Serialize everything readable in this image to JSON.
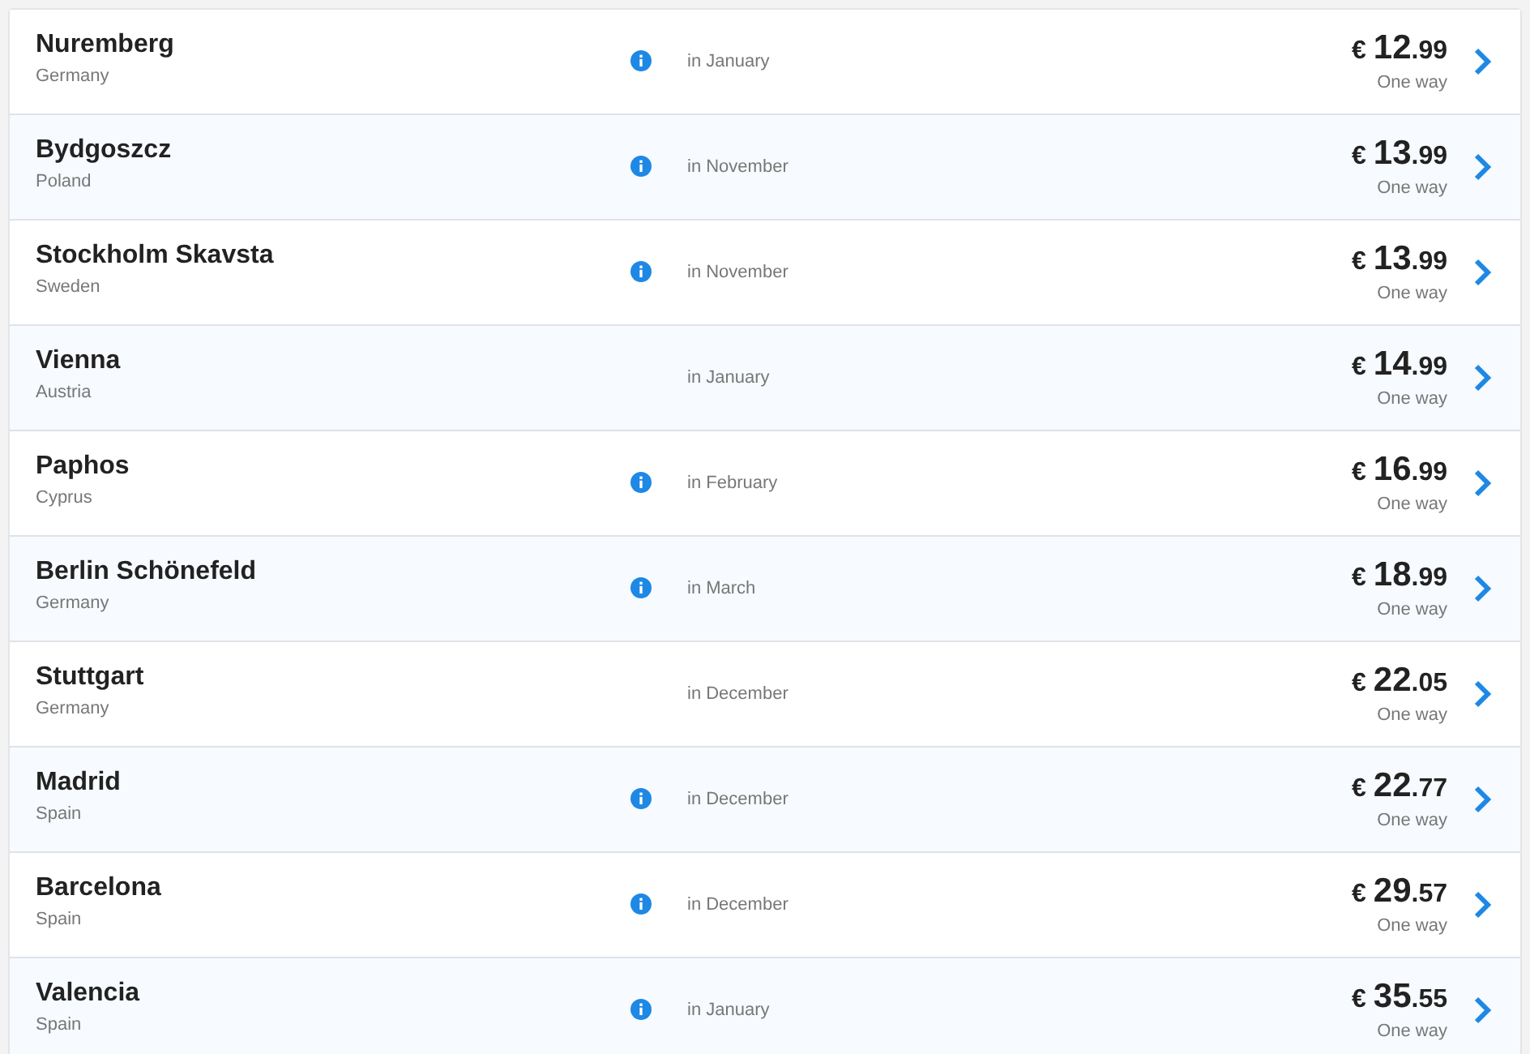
{
  "destinations": [
    {
      "city": "Nuremberg",
      "country": "Germany",
      "info": true,
      "when": "in January",
      "currency": "€",
      "whole": "12",
      "cents": ".99",
      "trip": "One way"
    },
    {
      "city": "Bydgoszcz",
      "country": "Poland",
      "info": true,
      "when": "in November",
      "currency": "€",
      "whole": "13",
      "cents": ".99",
      "trip": "One way"
    },
    {
      "city": "Stockholm Skavsta",
      "country": "Sweden",
      "info": true,
      "when": "in November",
      "currency": "€",
      "whole": "13",
      "cents": ".99",
      "trip": "One way"
    },
    {
      "city": "Vienna",
      "country": "Austria",
      "info": false,
      "when": "in January",
      "currency": "€",
      "whole": "14",
      "cents": ".99",
      "trip": "One way"
    },
    {
      "city": "Paphos",
      "country": "Cyprus",
      "info": true,
      "when": "in February",
      "currency": "€",
      "whole": "16",
      "cents": ".99",
      "trip": "One way"
    },
    {
      "city": "Berlin Schönefeld",
      "country": "Germany",
      "info": true,
      "when": "in March",
      "currency": "€",
      "whole": "18",
      "cents": ".99",
      "trip": "One way"
    },
    {
      "city": "Stuttgart",
      "country": "Germany",
      "info": false,
      "when": "in December",
      "currency": "€",
      "whole": "22",
      "cents": ".05",
      "trip": "One way"
    },
    {
      "city": "Madrid",
      "country": "Spain",
      "info": true,
      "when": "in December",
      "currency": "€",
      "whole": "22",
      "cents": ".77",
      "trip": "One way"
    },
    {
      "city": "Barcelona",
      "country": "Spain",
      "info": true,
      "when": "in December",
      "currency": "€",
      "whole": "29",
      "cents": ".57",
      "trip": "One way"
    },
    {
      "city": "Valencia",
      "country": "Spain",
      "info": true,
      "when": "in January",
      "currency": "€",
      "whole": "35",
      "cents": ".55",
      "trip": "One way"
    }
  ]
}
